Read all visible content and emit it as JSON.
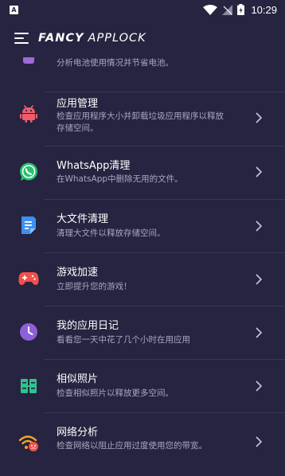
{
  "status_bar": {
    "notification_icon": "A",
    "time": "10:29"
  },
  "header": {
    "title_bold": "FANCY",
    "title_thin": "APPLOCK"
  },
  "items": [
    {
      "title": "",
      "desc": "分析电池使用情况并节省电池。",
      "icon": "battery-icon",
      "color": "#9b6bd6"
    },
    {
      "title": "应用管理",
      "desc": "检查应用程序大小并卸载垃圾应用程序以释放存储空间。",
      "icon": "android-icon",
      "color": "#ef5d6b"
    },
    {
      "title": "WhatsApp清理",
      "desc": "在WhatsApp中删除无用的文件。",
      "icon": "whatsapp-icon",
      "color": "#25c16f"
    },
    {
      "title": "大文件清理",
      "desc": "清理大文件以释放存储空间。",
      "icon": "document-icon",
      "color": "#3f8ff2"
    },
    {
      "title": "游戏加速",
      "desc": "立即提升您的游戏！",
      "icon": "gamepad-icon",
      "color": "#f2504b"
    },
    {
      "title": "我的应用日记",
      "desc": "看看您一天中花了几个小时在用应用",
      "icon": "clock-icon",
      "color": "#8f5fd8"
    },
    {
      "title": "相似照片",
      "desc": "检查相似照片以释放更多空间。",
      "icon": "similar-photos-icon",
      "color": "#2cc58e"
    },
    {
      "title": "网络分析",
      "desc": "检查网络以阻止应用过度使用您的带宽。",
      "icon": "wifi-analysis-icon",
      "color": "#f5a623"
    }
  ]
}
